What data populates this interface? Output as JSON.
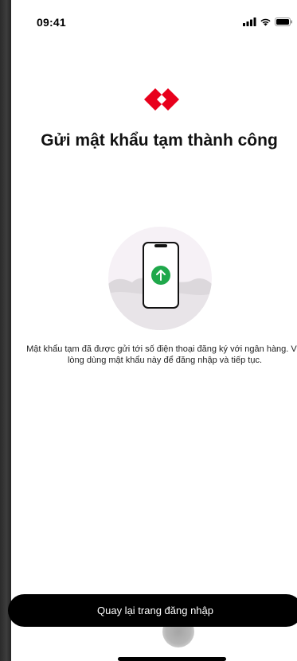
{
  "status_bar": {
    "time": "09:41"
  },
  "brand": {
    "logo_icon": "brand-logo-icon",
    "color": "#E8001C"
  },
  "main": {
    "title": "Gửi mật khẩu tạm thành công",
    "illustration_icon": "phone-upload-icon",
    "description": "Mật khẩu tạm đã được gửi tới số điện thoại đăng ký với ngân hàng. Vui lòng dùng mật khẩu này để đăng nhập và tiếp tục."
  },
  "actions": {
    "back_to_login_label": "Quay lại trang đăng nhập"
  },
  "colors": {
    "accent_green": "#1FA84B",
    "button_bg": "#000000"
  }
}
